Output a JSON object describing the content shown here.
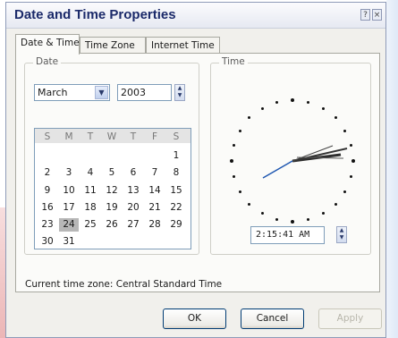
{
  "window": {
    "title": "Date and Time Properties",
    "help_label": "?",
    "close_label": "×"
  },
  "tabs": [
    {
      "label": "Date & Time",
      "active": true
    },
    {
      "label": "Time Zone",
      "active": false
    },
    {
      "label": "Internet Time",
      "active": false
    }
  ],
  "date_group": {
    "label": "Date",
    "month": "March",
    "year": "2003",
    "weekdays": [
      "S",
      "M",
      "T",
      "W",
      "T",
      "F",
      "S"
    ],
    "weeks": [
      [
        "",
        "",
        "",
        "",
        "",
        "",
        "1"
      ],
      [
        "2",
        "3",
        "4",
        "5",
        "6",
        "7",
        "8"
      ],
      [
        "9",
        "10",
        "11",
        "12",
        "13",
        "14",
        "15"
      ],
      [
        "16",
        "17",
        "18",
        "19",
        "20",
        "21",
        "22"
      ],
      [
        "23",
        "24",
        "25",
        "26",
        "27",
        "28",
        "29"
      ],
      [
        "30",
        "31",
        "",
        "",
        "",
        "",
        ""
      ]
    ],
    "selected_day": "24"
  },
  "time_group": {
    "label": "Time",
    "time_value": "2:15:41 AM"
  },
  "timezone_text": "Current time zone:  Central Standard Time",
  "buttons": {
    "ok": "OK",
    "cancel": "Cancel",
    "apply": "Apply"
  },
  "icons": {
    "dropdown": "chevron-down-icon",
    "spin": "spin-updown-icon"
  },
  "colors": {
    "title_text": "#1b2a6a",
    "selected_day_bg": "#b7b7b7",
    "button_border": "#003c74"
  }
}
